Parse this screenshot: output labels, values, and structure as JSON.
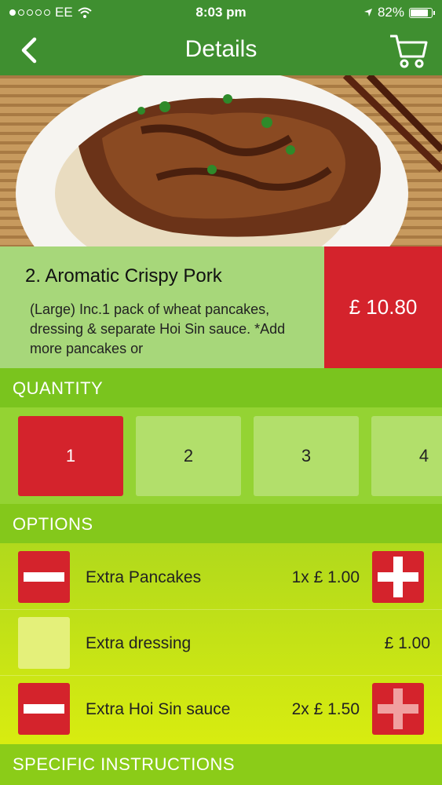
{
  "status_bar": {
    "carrier": "EE",
    "time": "8:03 pm",
    "battery": "82%"
  },
  "nav": {
    "title": "Details"
  },
  "item": {
    "name": "2. Aromatic Crispy Pork",
    "description": "(Large) Inc.1 pack of wheat pancakes, dressing & separate Hoi Sin sauce. *Add more pancakes or",
    "price": "£ 10.80"
  },
  "quantity": {
    "header": "QUANTITY",
    "options": [
      "1",
      "2",
      "3",
      "4"
    ],
    "selected": "1"
  },
  "options": {
    "header": "OPTIONS",
    "items": [
      {
        "label": "Extra Pancakes",
        "price": "1x £ 1.00"
      },
      {
        "label": "Extra dressing",
        "price": "£ 1.00"
      },
      {
        "label": "Extra Hoi Sin sauce",
        "price": "2x £ 1.50"
      }
    ]
  },
  "instructions": {
    "header": "SPECIFIC INSTRUCTIONS"
  },
  "colors": {
    "nav": "#3f8f30",
    "accent_red": "#d4232c",
    "green": "#7bc41e"
  }
}
